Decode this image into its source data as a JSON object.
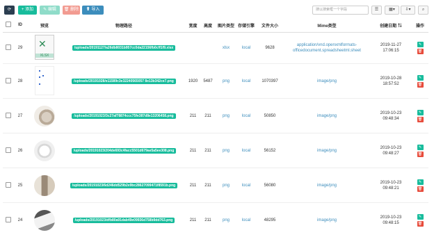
{
  "toolbar": {
    "refresh_icon": "refresh-icon",
    "add_label": "+ 添加",
    "edit_label": "✎ 编辑",
    "delete_label": "🗑 删除",
    "import_label": "⬆ 导入",
    "search_placeholder": "搜以搜索框一个字段",
    "colors": {
      "add": "#18bc9c",
      "refresh": "#2c3e50",
      "import": "#3c8dbc",
      "delete": "#f29b91",
      "edit": "#8fdcc9"
    }
  },
  "table": {
    "headers": [
      "ID",
      "预览",
      "物理路径",
      "宽度",
      "高度",
      "图片类型",
      "存储引擎",
      "文件大小",
      "Mime类型",
      "创建日期",
      "操作"
    ],
    "rows": [
      {
        "id": "29",
        "path": "/uploads/20191127/a26db8031b957cc0da22156fb0cff1f9.xlsx",
        "thumb_label": "XLSX",
        "width": "",
        "height": "",
        "type": "xlsx",
        "storage": "local",
        "size": "9628",
        "mime": "application/vnd.openxmlformats-officedocument.spreadsheetml.sheet",
        "date": "2019-11-27",
        "time": "17:06:15"
      },
      {
        "id": "28",
        "path": "/uploads/20191028/e11589c3e32240565057 8e13b342ce7.png",
        "thumb_label": "",
        "width": "1920",
        "height": "5487",
        "type": "png",
        "storage": "local",
        "size": "1070397",
        "mime": "image/png",
        "date": "2019-10-28",
        "time": "18:57:52"
      },
      {
        "id": "27",
        "path": "/uploads/20191023/3c27af78874ccc75fe387d8e13206458.png",
        "thumb_label": "",
        "width": "211",
        "height": "211",
        "type": "png",
        "storage": "local",
        "size": "50850",
        "mime": "image/png",
        "date": "2019-10-23",
        "time": "09:48:34"
      },
      {
        "id": "26",
        "path": "/uploads/20191023/204de693c4facc5501d679ae5a5ee308.png",
        "thumb_label": "",
        "width": "211",
        "height": "211",
        "type": "png",
        "storage": "local",
        "size": "56152",
        "mime": "image/png",
        "date": "2019-10-23",
        "time": "09:48:27"
      },
      {
        "id": "25",
        "path": "/uploads/20191023/6d246dd529b2e9bc28627099471f8591b.png",
        "thumb_label": "",
        "width": "211",
        "height": "211",
        "type": "png",
        "storage": "local",
        "size": "56080",
        "mime": "image/png",
        "date": "2019-10-23",
        "time": "09:48:21"
      },
      {
        "id": "24",
        "path": "/uploads/20191023/dfb80a91dab49e09936d758b9dd763.png",
        "thumb_label": "",
        "width": "211",
        "height": "211",
        "type": "png",
        "storage": "local",
        "size": "48295",
        "mime": "image/png",
        "date": "2019-10-23",
        "time": "09:48:15"
      }
    ]
  }
}
